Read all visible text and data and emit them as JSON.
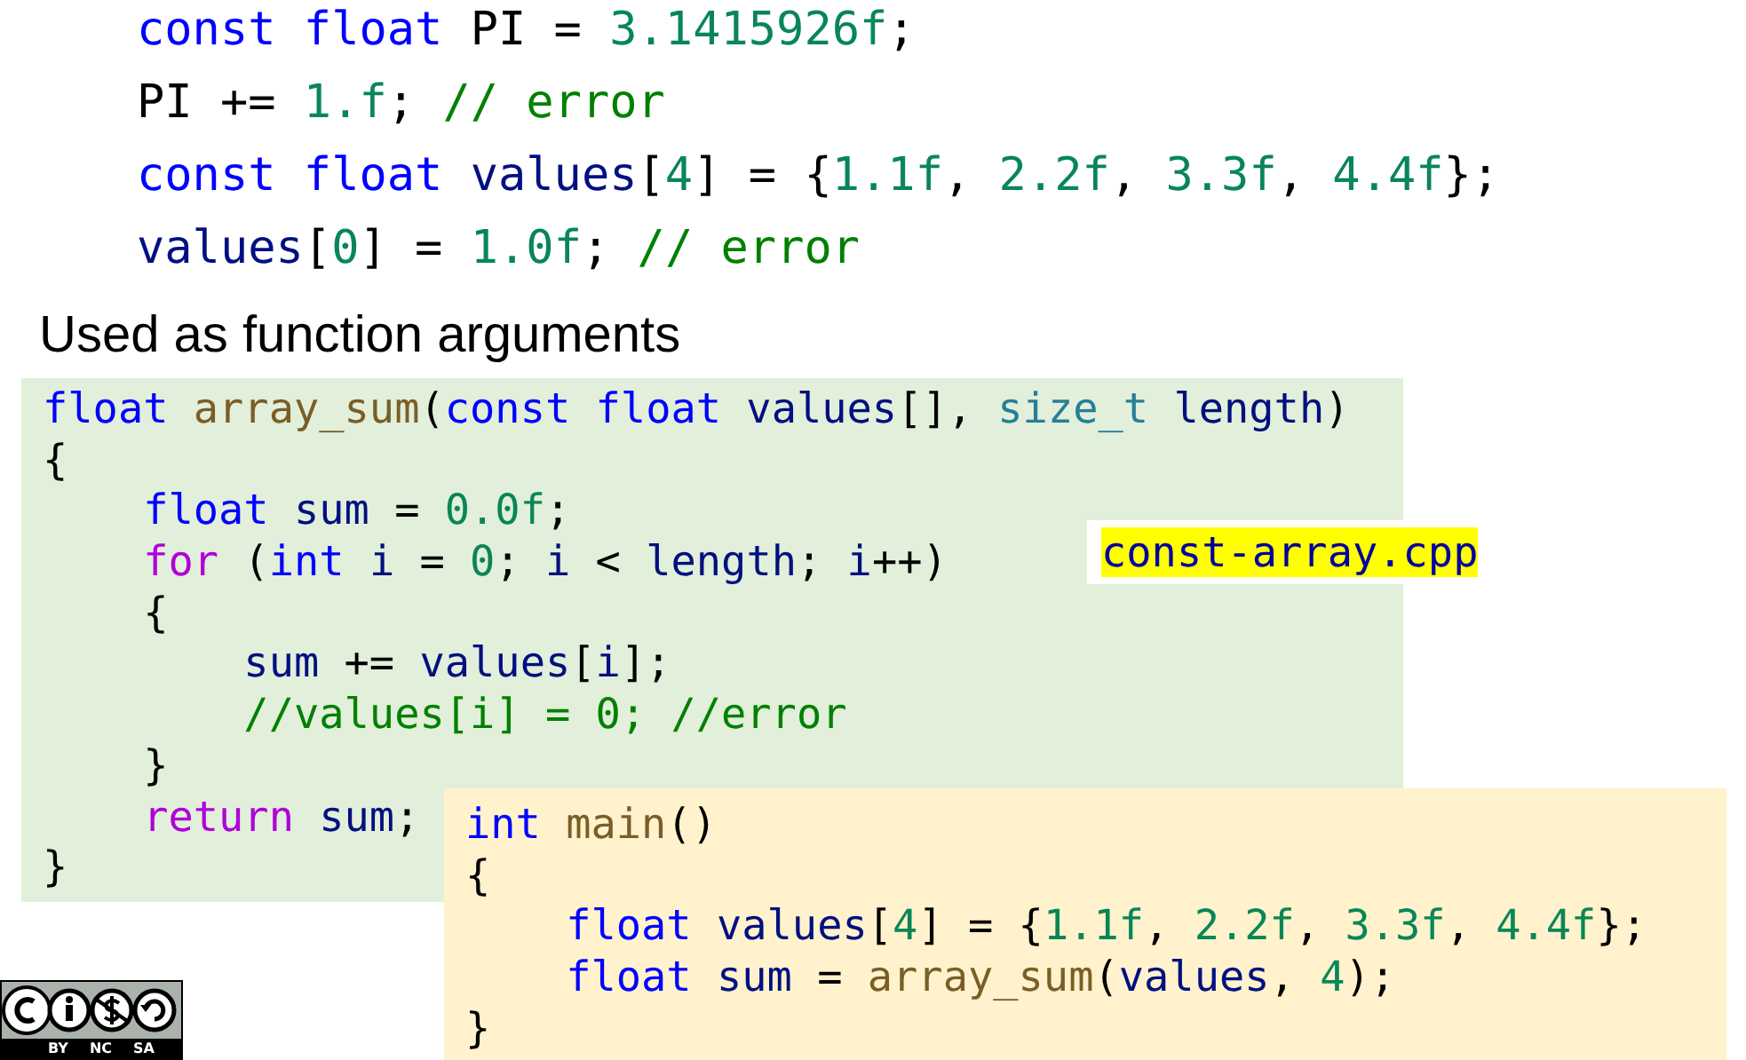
{
  "top_code": [
    [
      {
        "kind": "keyword",
        "t": "const float "
      },
      {
        "kind": "plain",
        "t": "PI = "
      },
      {
        "kind": "number",
        "t": "3.1415926f"
      },
      {
        "kind": "plain",
        "t": ";"
      }
    ],
    [
      {
        "kind": "plain",
        "t": "PI += "
      },
      {
        "kind": "number",
        "t": "1.f"
      },
      {
        "kind": "plain",
        "t": "; "
      },
      {
        "kind": "comment",
        "t": "// error"
      }
    ],
    [
      {
        "kind": "keyword",
        "t": "const float "
      },
      {
        "kind": "variable",
        "t": "values"
      },
      {
        "kind": "plain",
        "t": "["
      },
      {
        "kind": "number",
        "t": "4"
      },
      {
        "kind": "plain",
        "t": "] = {"
      },
      {
        "kind": "number",
        "t": "1.1f"
      },
      {
        "kind": "plain",
        "t": ", "
      },
      {
        "kind": "number",
        "t": "2.2f"
      },
      {
        "kind": "plain",
        "t": ", "
      },
      {
        "kind": "number",
        "t": "3.3f"
      },
      {
        "kind": "plain",
        "t": ", "
      },
      {
        "kind": "number",
        "t": "4.4f"
      },
      {
        "kind": "plain",
        "t": "};"
      }
    ],
    [
      {
        "kind": "variable",
        "t": "values"
      },
      {
        "kind": "plain",
        "t": "["
      },
      {
        "kind": "number",
        "t": "0"
      },
      {
        "kind": "plain",
        "t": "] = "
      },
      {
        "kind": "number",
        "t": "1.0f"
      },
      {
        "kind": "plain",
        "t": "; "
      },
      {
        "kind": "comment",
        "t": "// error"
      }
    ]
  ],
  "heading": "Used as function arguments",
  "function_code": [
    [
      {
        "kind": "keyword",
        "t": "float "
      },
      {
        "kind": "function",
        "t": "array_sum"
      },
      {
        "kind": "plain",
        "t": "("
      },
      {
        "kind": "keyword",
        "t": "const float "
      },
      {
        "kind": "variable",
        "t": "values"
      },
      {
        "kind": "plain",
        "t": "[], "
      },
      {
        "kind": "type",
        "t": "size_t "
      },
      {
        "kind": "variable",
        "t": "length"
      },
      {
        "kind": "plain",
        "t": ")"
      }
    ],
    [
      {
        "kind": "plain",
        "t": "{"
      }
    ],
    [
      {
        "kind": "keyword",
        "t": "    float "
      },
      {
        "kind": "variable",
        "t": "sum"
      },
      {
        "kind": "plain",
        "t": " = "
      },
      {
        "kind": "number",
        "t": "0.0f"
      },
      {
        "kind": "plain",
        "t": ";"
      }
    ],
    [
      {
        "kind": "control",
        "t": "    for "
      },
      {
        "kind": "plain",
        "t": "("
      },
      {
        "kind": "keyword",
        "t": "int "
      },
      {
        "kind": "variable",
        "t": "i"
      },
      {
        "kind": "plain",
        "t": " = "
      },
      {
        "kind": "number",
        "t": "0"
      },
      {
        "kind": "plain",
        "t": "; "
      },
      {
        "kind": "variable",
        "t": "i"
      },
      {
        "kind": "plain",
        "t": " < "
      },
      {
        "kind": "variable",
        "t": "length"
      },
      {
        "kind": "plain",
        "t": "; "
      },
      {
        "kind": "variable",
        "t": "i"
      },
      {
        "kind": "plain",
        "t": "++)"
      }
    ],
    [
      {
        "kind": "plain",
        "t": "    {"
      }
    ],
    [
      {
        "kind": "variable",
        "t": "        sum"
      },
      {
        "kind": "plain",
        "t": " += "
      },
      {
        "kind": "variable",
        "t": "values"
      },
      {
        "kind": "plain",
        "t": "["
      },
      {
        "kind": "variable",
        "t": "i"
      },
      {
        "kind": "plain",
        "t": "];"
      }
    ],
    [
      {
        "kind": "comment",
        "t": "        //values[i] = 0; //error"
      }
    ],
    [
      {
        "kind": "plain",
        "t": "    }"
      }
    ],
    [
      {
        "kind": "control",
        "t": "    return "
      },
      {
        "kind": "variable",
        "t": "sum"
      },
      {
        "kind": "plain",
        "t": ";"
      }
    ],
    [
      {
        "kind": "plain",
        "t": "}"
      }
    ]
  ],
  "filename": "const-array.cpp",
  "main_code": [
    [
      {
        "kind": "keyword",
        "t": "int "
      },
      {
        "kind": "function",
        "t": "main"
      },
      {
        "kind": "plain",
        "t": "()"
      }
    ],
    [
      {
        "kind": "plain",
        "t": "{"
      }
    ],
    [
      {
        "kind": "keyword",
        "t": "    float "
      },
      {
        "kind": "variable",
        "t": "values"
      },
      {
        "kind": "plain",
        "t": "["
      },
      {
        "kind": "number",
        "t": "4"
      },
      {
        "kind": "plain",
        "t": "] = {"
      },
      {
        "kind": "number",
        "t": "1.1f"
      },
      {
        "kind": "plain",
        "t": ", "
      },
      {
        "kind": "number",
        "t": "2.2f"
      },
      {
        "kind": "plain",
        "t": ", "
      },
      {
        "kind": "number",
        "t": "3.3f"
      },
      {
        "kind": "plain",
        "t": ", "
      },
      {
        "kind": "number",
        "t": "4.4f"
      },
      {
        "kind": "plain",
        "t": "};"
      }
    ],
    [
      {
        "kind": "keyword",
        "t": "    float "
      },
      {
        "kind": "variable",
        "t": "sum"
      },
      {
        "kind": "plain",
        "t": " = "
      },
      {
        "kind": "function",
        "t": "array_sum"
      },
      {
        "kind": "plain",
        "t": "("
      },
      {
        "kind": "variable",
        "t": "values"
      },
      {
        "kind": "plain",
        "t": ", "
      },
      {
        "kind": "number",
        "t": "4"
      },
      {
        "kind": "plain",
        "t": ");"
      }
    ],
    [
      {
        "kind": "plain",
        "t": "}"
      }
    ]
  ],
  "license_badge": {
    "labels": [
      "BY",
      "NC",
      "SA"
    ]
  }
}
